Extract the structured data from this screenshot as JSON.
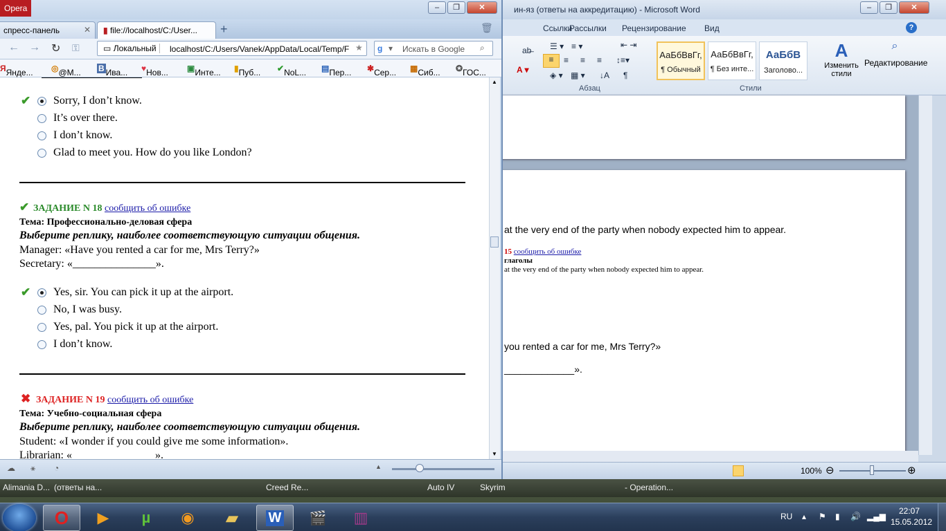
{
  "taskstrip": {
    "items": [
      "Alimania D...",
      "(ответы на...",
      "Creed Re...",
      "Auto IV",
      "Skyrim",
      "- Operation..."
    ]
  },
  "tray": {
    "lang": "RU",
    "time": "22:07",
    "date": "15.05.2012"
  },
  "word": {
    "title": "ин-яз (ответы на аккредитацию)  -  Microsoft Word",
    "tabs": [
      "Ссылки",
      "Рассылки",
      "Рецензирование",
      "Вид"
    ],
    "groups": {
      "paragraph": "Абзац",
      "styles": "Стили"
    },
    "styles": [
      {
        "preview": "АаБбВвГг,",
        "name": "¶ Обычный"
      },
      {
        "preview": "АаБбВвГг,",
        "name": "¶ Без инте..."
      },
      {
        "preview": "АаБбВ",
        "name": "Заголово..."
      }
    ],
    "change_styles": "Изменить стили",
    "editing": "Редактирование",
    "doc": {
      "line1": "at the very end of the party when nobody expected him to appear.",
      "num": "15",
      "report": "сообщить об ошибке",
      "sub": "глаголы",
      "line2": "at the very end of the party when nobody expected him to appear.",
      "line3": "you rented a car for me, Mrs Terry?»",
      "line4": "_____________»."
    },
    "zoom": "100%"
  },
  "opera": {
    "app": "Opera",
    "tabs": [
      "спресс-панель",
      "file://localhost/C:/User..."
    ],
    "address_label": "Локальный",
    "address": "localhost/C:/Users/Vanek/AppData/Local/Temp/F",
    "search_placeholder": "Искать в Google",
    "bookmarks": [
      "Янде...",
      "@M...",
      "Ива...",
      "Нов...",
      "Инте...",
      "Пуб...",
      "NoL...",
      "Пер...",
      "Сер...",
      "Сиб...",
      "ГОС..."
    ],
    "q17_opts": [
      "Sorry, I don’t know.",
      "It’s over there.",
      "I don’t know.",
      "Glad to meet you. How do you like London?"
    ],
    "q18": {
      "title": "ЗАДАНИЕ N 18",
      "report": "сообщить об ошибке",
      "topic": "Тема: Профессионально-деловая сфера",
      "instr": "Выберите реплику, наиболее соответствующую ситуации общения.",
      "l1": "Manager: «Have you rented a car for me, Mrs Terry?»",
      "l2": "Secretary: «_______________»."
    },
    "q18_opts": [
      "Yes, sir. You can pick it up at the airport.",
      "No, I was busy.",
      "Yes, pal. You pick it up at the airport.",
      "I don’t know."
    ],
    "q19": {
      "title": "ЗАДАНИЕ N 19",
      "report": "сообщить об ошибке",
      "topic": "Тема: Учебно-социальная сфера",
      "instr": "Выберите реплику, наиболее соответствующую ситуации общения.",
      "l1": "Student: «I wonder if you could give me some information».",
      "l2": "Librarian: «_______________»."
    }
  }
}
